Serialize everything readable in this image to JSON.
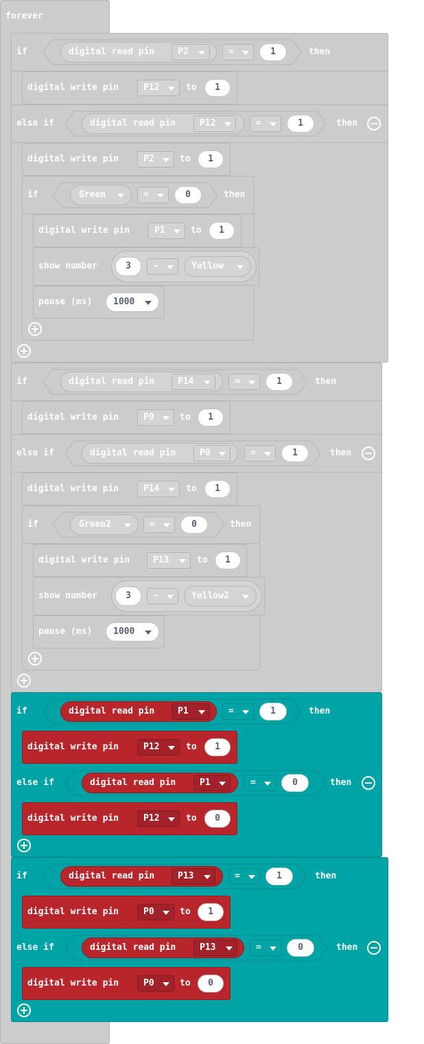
{
  "forever_label": "forever",
  "kw": {
    "if": "if",
    "else_if": "else if",
    "then": "then",
    "to": "to"
  },
  "b1": {
    "cond": {
      "block": "digital read pin",
      "pin": "P2",
      "op": "=",
      "val": "1"
    },
    "w1": {
      "label": "digital write pin",
      "pin": "P12",
      "val": "1"
    },
    "elif": {
      "block": "digital read pin",
      "pin": "P12",
      "op": "=",
      "val": "1"
    },
    "w2": {
      "label": "digital write pin",
      "pin": "P2",
      "val": "1"
    },
    "inner": {
      "var": "Green",
      "op": "=",
      "val": "0"
    },
    "w3": {
      "label": "digital write pin",
      "pin": "P1",
      "val": "1"
    },
    "show": {
      "label": "show number",
      "a": "3",
      "op": "-",
      "var": "Yellow"
    },
    "pause": {
      "label": "pause (ms)",
      "val": "1000"
    }
  },
  "b2": {
    "cond": {
      "block": "digital read pin",
      "pin": "P14",
      "op": "=",
      "val": "1"
    },
    "w1": {
      "label": "digital write pin",
      "pin": "P0",
      "val": "1"
    },
    "elif": {
      "block": "digital read pin",
      "pin": "P0",
      "op": "=",
      "val": "1"
    },
    "w2": {
      "label": "digital write pin",
      "pin": "P14",
      "val": "1"
    },
    "inner": {
      "var": "Green2",
      "op": "=",
      "val": "0"
    },
    "w3": {
      "label": "digital write pin",
      "pin": "P13",
      "val": "1"
    },
    "show": {
      "label": "show number",
      "a": "3",
      "op": "-",
      "var": "Yellow2"
    },
    "pause": {
      "label": "pause (ms)",
      "val": "1000"
    }
  },
  "b3": {
    "cond": {
      "block": "digital read pin",
      "pin": "P1",
      "op": "=",
      "val": "1"
    },
    "w1": {
      "label": "digital write pin",
      "pin": "P12",
      "val": "1"
    },
    "elif": {
      "block": "digital read pin",
      "pin": "P1",
      "op": "=",
      "val": "0"
    },
    "w2": {
      "label": "digital write pin",
      "pin": "P12",
      "val": "0"
    }
  },
  "b4": {
    "cond": {
      "block": "digital read pin",
      "pin": "P13",
      "op": "=",
      "val": "1"
    },
    "w1": {
      "label": "digital write pin",
      "pin": "P0",
      "val": "1"
    },
    "elif": {
      "block": "digital read pin",
      "pin": "P13",
      "op": "=",
      "val": "0"
    },
    "w2": {
      "label": "digital write pin",
      "pin": "P0",
      "val": "0"
    }
  },
  "colors": {
    "disabled": "#cccccc",
    "logic": "#00a4a6",
    "pins": "#b8262c"
  }
}
